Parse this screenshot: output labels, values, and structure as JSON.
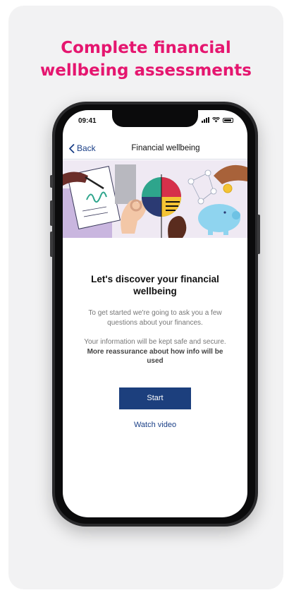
{
  "page": {
    "headline_line1": "Complete financial",
    "headline_line2": "wellbeing assessments"
  },
  "status_bar": {
    "time": "09:41"
  },
  "nav": {
    "back_label": "Back",
    "title": "Financial wellbeing"
  },
  "main": {
    "heading": "Let's discover your financial wellbeing",
    "intro": "To get started we're going to ask you a few questions about your finances.",
    "privacy_prefix": "Your information will be kept safe and secure.",
    "privacy_link": "More reassurance about how info will be used",
    "start_label": "Start",
    "watch_label": "Watch video"
  },
  "colors": {
    "accent": "#e5166f",
    "brand_blue": "#1c3f7d",
    "card_bg": "#f2f2f3"
  }
}
